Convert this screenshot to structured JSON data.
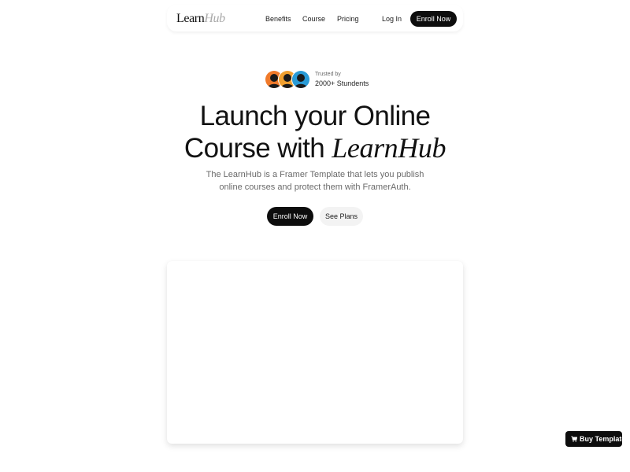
{
  "nav": {
    "logo": {
      "primary": "Learn",
      "accent": "Hub"
    },
    "links": [
      {
        "label": "Benefits"
      },
      {
        "label": "Course"
      },
      {
        "label": "Pricing"
      }
    ],
    "login_label": "Log In",
    "enroll_label": "Enroll Now"
  },
  "hero": {
    "trust": {
      "small": "Trusted by",
      "big": "2000+ Stundents",
      "avatar_colors": [
        "#f07a2a",
        "#f0a030",
        "#2a9bd6"
      ]
    },
    "headline": {
      "line1": "Launch your Online",
      "line2_prefix": "Course with ",
      "brand": "LearnHub"
    },
    "subtitle": "The LearnHub is a Framer Template that lets you publish online courses and protect them with FramerAuth.",
    "primary_cta": "Enroll Now",
    "secondary_cta": "See Plans"
  },
  "floating": {
    "buy_label": "Buy Template",
    "buy_icon": "cart-icon"
  },
  "colors": {
    "primary": "#0d0d0d",
    "background": "#ffffff",
    "muted_text": "#6a6a6a",
    "secondary_button": "#f3f3f3"
  }
}
